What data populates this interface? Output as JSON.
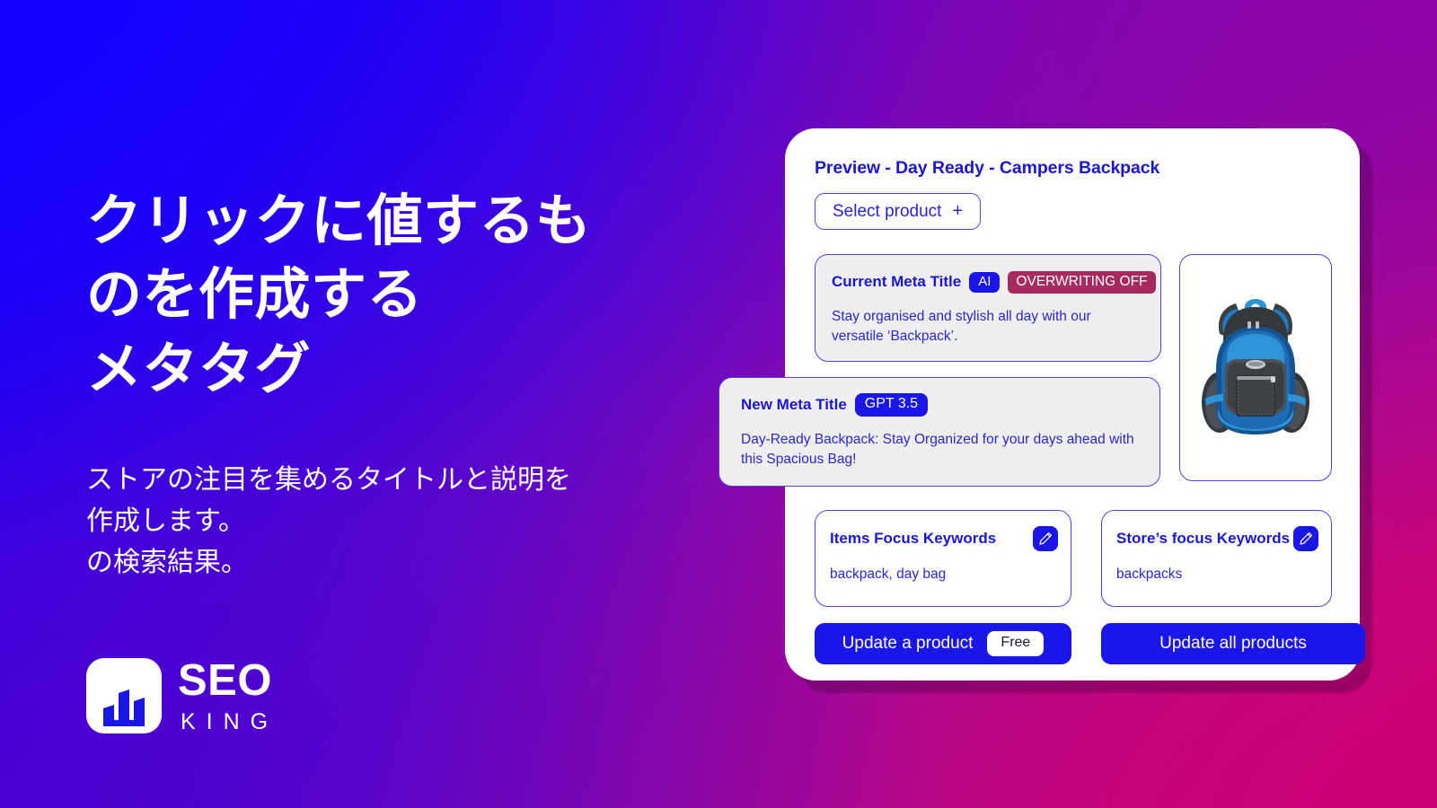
{
  "theme": {
    "bg_blue": "#1000ff",
    "bg_purple": "#8800aa",
    "bg_violet": "#4a00d0",
    "bg_magenta": "#cd0076",
    "accent_blue": "#1a16e8",
    "badge_maroon": "#a72a5f",
    "card_grey": "#efeff1",
    "text_white": "#ffffff"
  },
  "hero": {
    "headline": "クリックに値するも\nのを作成する\nメタタグ",
    "subheadline": "ストアの注目を集めるタイトルと説明を\n作成します。\nの検索結果。",
    "logo": {
      "mark_icon": "bar-chart-crown-icon",
      "primary_text": "SEO",
      "secondary_text": "KING"
    }
  },
  "panel": {
    "title": "Preview - Day Ready - Campers Backpack",
    "select_product": {
      "label": "Select product",
      "plus_icon": "+"
    },
    "current_meta": {
      "label": "Current Meta Title",
      "badge_ai": "AI",
      "badge_status": "OVERWRITING OFF",
      "text": "Stay organised and stylish all day with our versatile ‘Backpack’."
    },
    "new_meta": {
      "label": "New Meta Title",
      "badge_model": "GPT 3.5",
      "text": "Day-Ready Backpack: Stay Organized for your days ahead with this Spacious Bag!"
    },
    "product_image": {
      "icon": "backpack-illustration"
    },
    "keyword_cards": [
      {
        "title": "Items Focus Keywords",
        "value": "backpack, day bag",
        "edit_icon": "pencil-icon"
      },
      {
        "title": "Store’s focus Keywords",
        "value": "backpacks",
        "edit_icon": "pencil-icon"
      }
    ],
    "actions": {
      "update_one": {
        "label": "Update a product",
        "pill": "Free"
      },
      "update_all": {
        "label": "Update all products"
      }
    }
  }
}
